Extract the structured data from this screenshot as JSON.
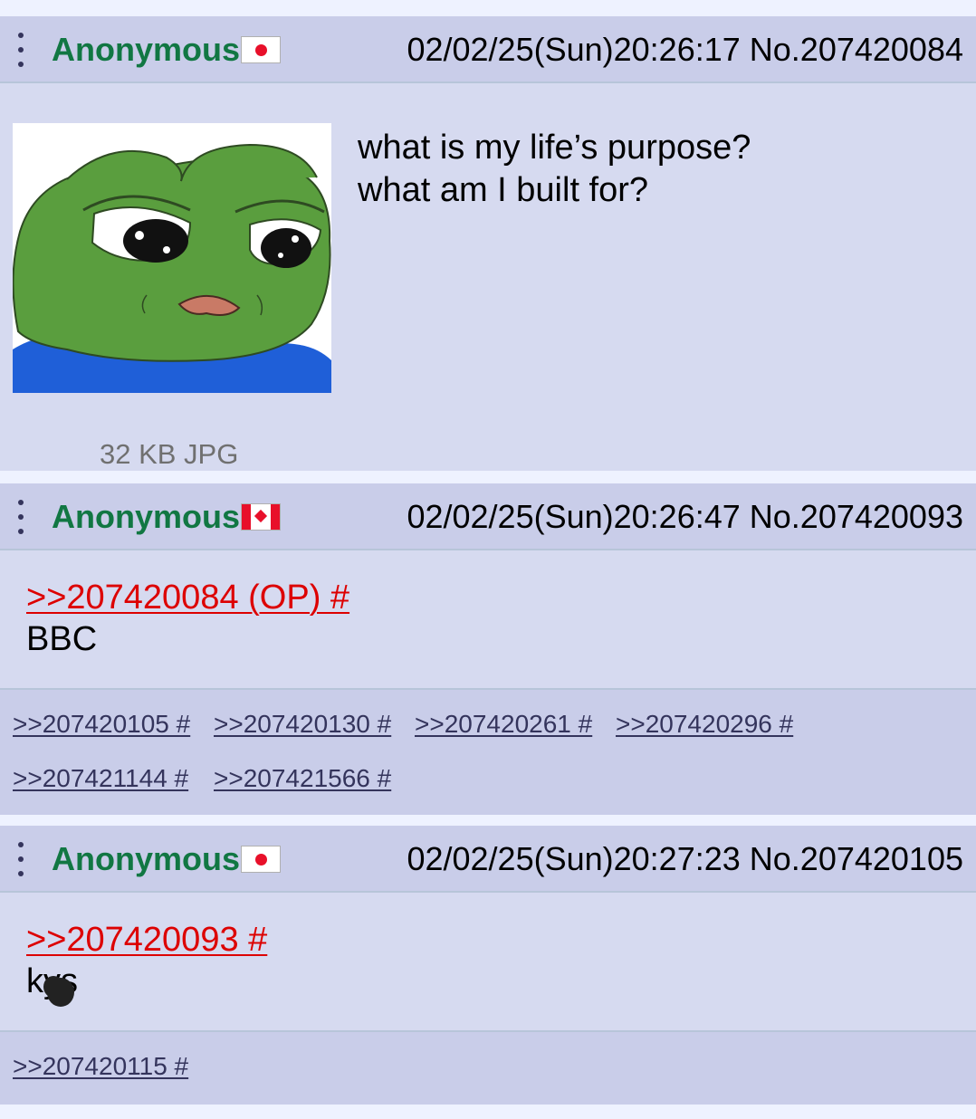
{
  "posts": [
    {
      "name": "Anonymous",
      "flag": "japan-flag",
      "datetime": "02/02/25(Sun)20:26:17",
      "number": "No.207420084",
      "body_lines": [
        "what is my life’s purpose?",
        "what am I built for?"
      ],
      "file_info": "32 KB JPG",
      "image": "sad-pepe-frog"
    },
    {
      "name": "Anonymous",
      "flag": "canada-flag",
      "datetime": "02/02/25(Sun)20:26:47",
      "number": "No.207420093",
      "quote": ">>207420084 (OP) #",
      "body": "BBC",
      "backlinks": [
        ">>207420105 #",
        ">>207420130 #",
        ">>207420261 #",
        ">>207420296 #",
        ">>207421144 #",
        ">>207421566 #"
      ]
    },
    {
      "name": "Anonymous",
      "flag": "japan-flag",
      "datetime": "02/02/25(Sun)20:27:23",
      "number": "No.207420105",
      "quote": ">>207420093 #",
      "body": "kys",
      "backlinks": [
        ">>207420115 #"
      ]
    }
  ],
  "colors": {
    "name": "#117743",
    "quote_link": "#dd0000",
    "backlink": "#34345c",
    "post_bg": "#d6daf0",
    "header_bg": "#c9cde9",
    "page_bg": "#eef2ff"
  }
}
